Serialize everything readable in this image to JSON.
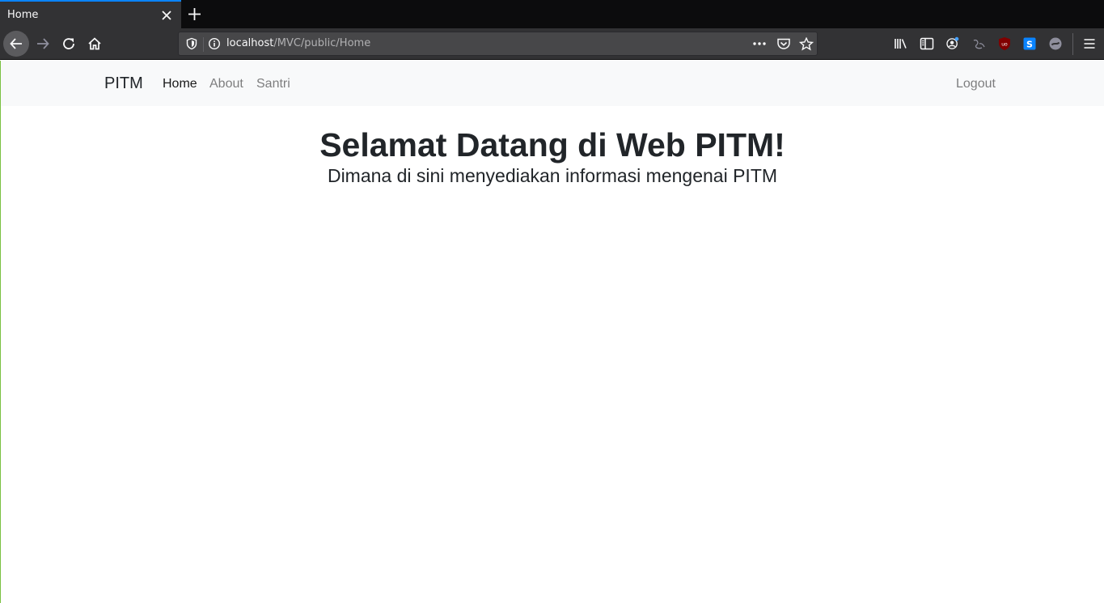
{
  "browser": {
    "tab_title": "Home",
    "url_host": "localhost",
    "url_path": "/MVC/public/Home",
    "accent_color": "#0a84ff",
    "icons": [
      "shield-icon",
      "info-icon",
      "page-actions-icon",
      "pocket-icon",
      "bookmark-star-icon",
      "library-icon",
      "sidebar-icon",
      "account-icon",
      "ublock-icon",
      "menu-icon"
    ]
  },
  "site": {
    "brand": "PITM",
    "nav": {
      "home": "Home",
      "about": "About",
      "santri": "Santri",
      "logout": "Logout"
    },
    "hero": {
      "title": "Selamat Datang di Web PITM!",
      "subtitle": "Dimana di sini menyediakan informasi mengenai PITM"
    }
  }
}
